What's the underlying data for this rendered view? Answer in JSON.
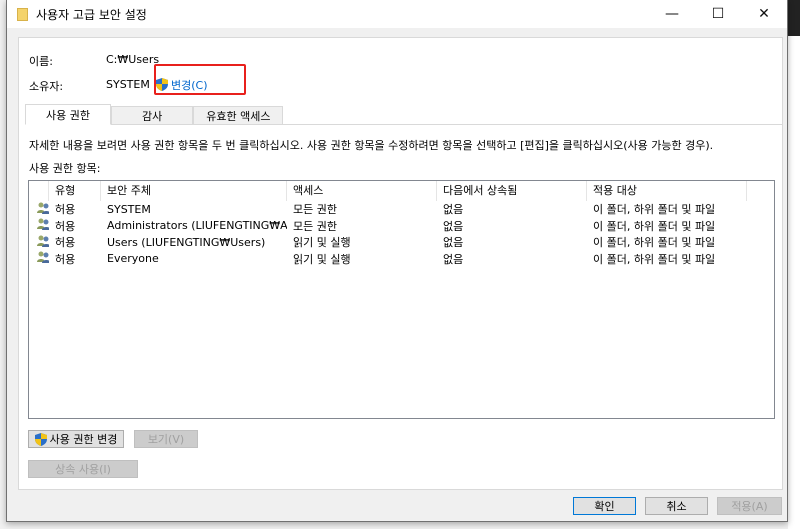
{
  "window": {
    "title": "사용자 고급 보안 설정",
    "minimize": "—",
    "maximize": "☐",
    "close": "✕"
  },
  "info": {
    "name_label": "이름:",
    "name_value": "C:₩Users",
    "owner_label": "소유자:",
    "owner_value": "SYSTEM",
    "change_link": "변경(C)"
  },
  "tabs": [
    {
      "label": "사용 권한",
      "active": true
    },
    {
      "label": "감사"
    },
    {
      "label": "유효한 액세스"
    }
  ],
  "description": "자세한 내용을 보려면 사용 권한 항목을 두 번 클릭하십시오. 사용 권한 항목을 수정하려면 항목을 선택하고 [편집]을 클릭하십시오(사용 가능한 경우).",
  "entries_label": "사용 권한 항목:",
  "columns": [
    "유형",
    "보안 주체",
    "액세스",
    "다음에서 상속됨",
    "적용 대상"
  ],
  "rows": [
    [
      "허용",
      "SYSTEM",
      "모든 권한",
      "없음",
      "이 폴더, 하위 폴더 및 파일"
    ],
    [
      "허용",
      "Administrators (LIUFENGTING₩Ad...",
      "모든 권한",
      "없음",
      "이 폴더, 하위 폴더 및 파일"
    ],
    [
      "허용",
      "Users (LIUFENGTING₩Users)",
      "읽기 및 실행",
      "없음",
      "이 폴더, 하위 폴더 및 파일"
    ],
    [
      "허용",
      "Everyone",
      "읽기 및 실행",
      "없음",
      "이 폴더, 하위 폴더 및 파일"
    ]
  ],
  "buttons": {
    "change_permissions": "사용 권한 변경",
    "view": "보기(V)",
    "enable_inheritance": "상속 사용(I)",
    "ok": "확인",
    "cancel": "취소",
    "apply": "적용(A)"
  },
  "colors": {
    "link": "#0066cc",
    "highlight": "#e8201c",
    "default_button": "#0078d7"
  }
}
